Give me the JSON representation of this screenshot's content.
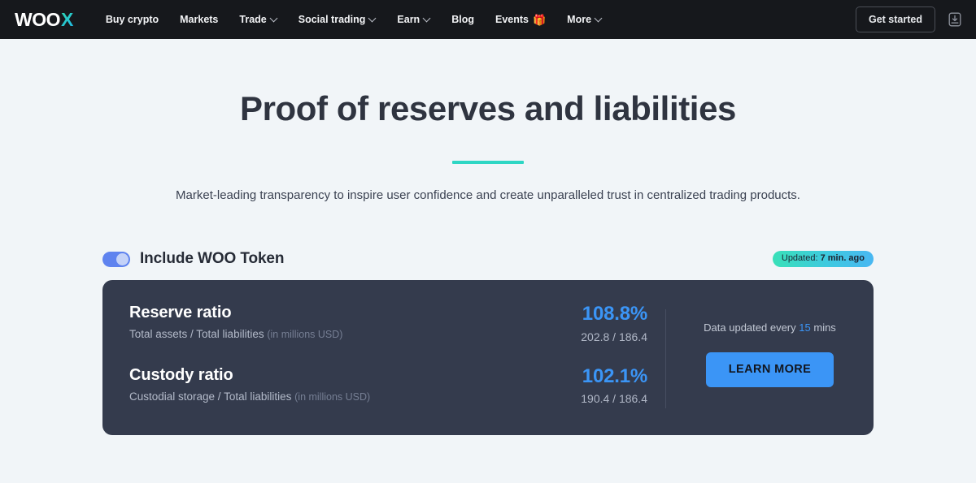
{
  "navbar": {
    "logo": {
      "woo": "WOO",
      "x": "X"
    },
    "links": [
      {
        "label": "Buy crypto",
        "has_dropdown": false
      },
      {
        "label": "Markets",
        "has_dropdown": false
      },
      {
        "label": "Trade",
        "has_dropdown": true
      },
      {
        "label": "Social trading",
        "has_dropdown": true
      },
      {
        "label": "Earn",
        "has_dropdown": true
      },
      {
        "label": "Blog",
        "has_dropdown": false
      },
      {
        "label": "Events",
        "has_dropdown": false,
        "emoji": "🎁"
      },
      {
        "label": "More",
        "has_dropdown": true
      }
    ],
    "get_started_label": "Get started",
    "download_icon": "download-app-icon"
  },
  "hero": {
    "title": "Proof of reserves and liabilities",
    "accent_color": "#2ed6c4",
    "subtitle": "Market-leading transparency to inspire user confidence and create unparalleled trust in centralized trading products."
  },
  "controls": {
    "toggle": {
      "label": "Include WOO Token",
      "state": "on",
      "color": "#5f83ef"
    },
    "updated_badge": {
      "prefix": "Updated:",
      "value": "7 min. ago"
    }
  },
  "card": {
    "rows": [
      {
        "name": "Reserve ratio",
        "description": "Total assets / Total liabilities",
        "unit": "(in millions USD)",
        "percent": "108.8%",
        "values": "202.8 / 186.4"
      },
      {
        "name": "Custody ratio",
        "description": "Custodial storage / Total liabilities",
        "unit": "(in millions USD)",
        "percent": "102.1%",
        "values": "190.4 / 186.4"
      }
    ],
    "update_note": {
      "prefix": "Data updated every",
      "interval": "15",
      "suffix": "mins"
    },
    "learn_more_label": "LEARN MORE",
    "accent_color": "#3b95f6",
    "background_color": "#343b4d"
  }
}
